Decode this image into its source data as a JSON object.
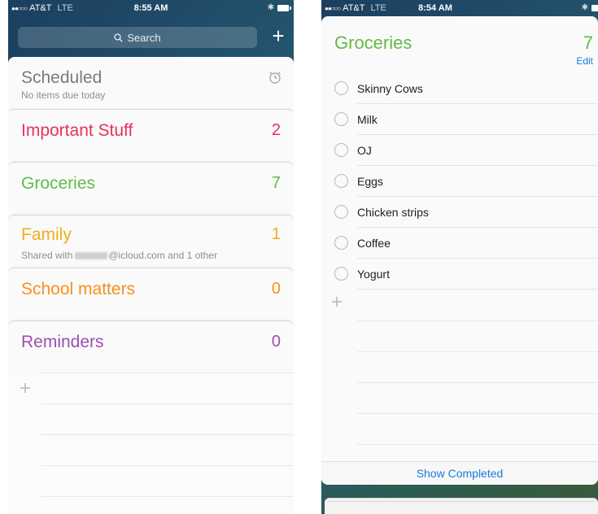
{
  "left": {
    "status": {
      "carrier": "AT&T",
      "network": "LTE",
      "time": "8:55 AM"
    },
    "search": {
      "placeholder": "Search"
    },
    "add_label": "+",
    "scheduled": {
      "title": "Scheduled",
      "subtitle": "No items due today"
    },
    "lists": [
      {
        "name": "Important Stuff",
        "count": "2",
        "color": "#e8305c"
      },
      {
        "name": "Groceries",
        "count": "7",
        "color": "#62bb46"
      },
      {
        "name": "Family",
        "count": "1",
        "color": "#f2ac1c",
        "shared_prefix": "Shared with",
        "shared_suffix": "@icloud.com and 1 other"
      },
      {
        "name": "School matters",
        "count": "0",
        "color": "#f7901e"
      },
      {
        "name": "Reminders",
        "count": "0",
        "color": "#9b4fb0"
      }
    ],
    "new_list_label": "+"
  },
  "right": {
    "status": {
      "carrier": "AT&T",
      "network": "LTE",
      "time": "8:54 AM"
    },
    "list": {
      "title": "Groceries",
      "count": "7",
      "color": "#62bb46",
      "edit_label": "Edit"
    },
    "items": [
      "Skinny Cows",
      "Milk",
      "OJ",
      "Eggs",
      "Chicken strips",
      "Coffee",
      "Yogurt"
    ],
    "new_item_label": "+",
    "footer": {
      "show_completed_label": "Show Completed"
    }
  },
  "icons": {
    "search": "search-icon",
    "alarm": "alarm-clock-icon",
    "bluetooth": "bluetooth-icon",
    "battery": "battery-icon",
    "signal": "signal-dots-icon"
  }
}
